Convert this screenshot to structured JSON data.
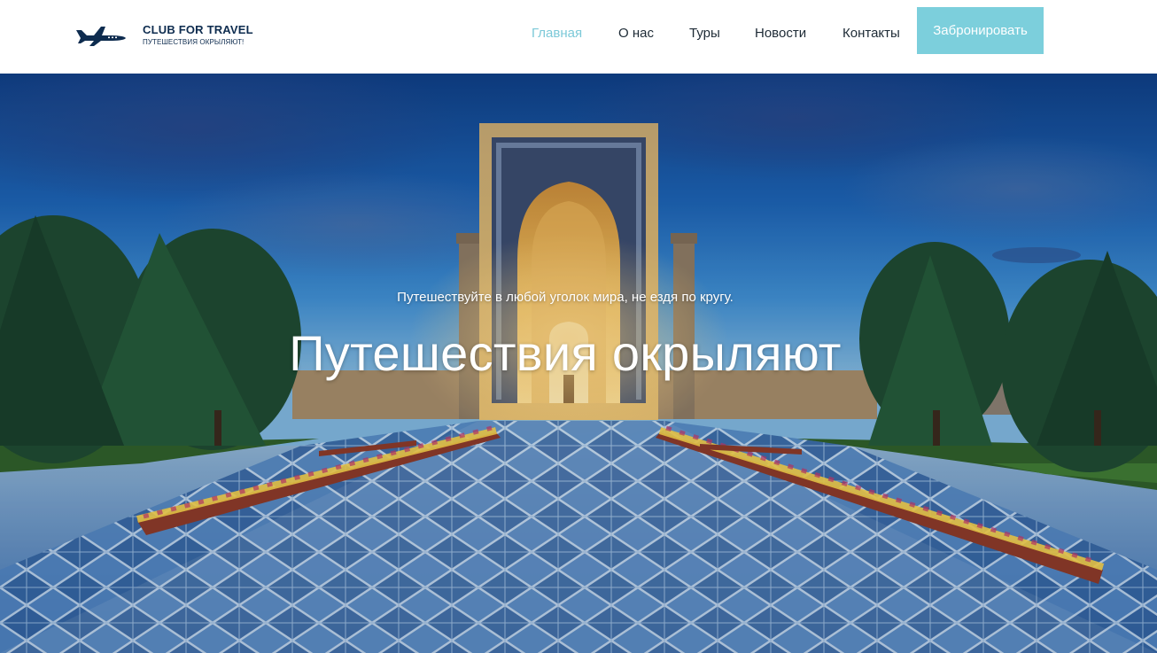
{
  "brand": {
    "title": "CLUB FOR TRAVEL",
    "subtitle": "ПУТЕШЕСТВИЯ ОКРЫЛЯЮТ!",
    "icon": "airplane-icon"
  },
  "nav": {
    "items": [
      {
        "label": "Главная",
        "active": true
      },
      {
        "label": "О нас",
        "active": false
      },
      {
        "label": "Туры",
        "active": false
      },
      {
        "label": "Новости",
        "active": false
      },
      {
        "label": "Контакты",
        "active": false
      }
    ],
    "active_color": "#7cc9d8",
    "text_color": "#1d2a35"
  },
  "cta": {
    "label": "Забронировать",
    "color": "#7ccfdc"
  },
  "hero": {
    "subtitle": "Путешествуйте в любой уголок мира, не ездя по кругу.",
    "title": "Путешествия окрыляют"
  },
  "colors": {
    "brand": "#0e2c4f",
    "accent": "#7ccfdc"
  }
}
